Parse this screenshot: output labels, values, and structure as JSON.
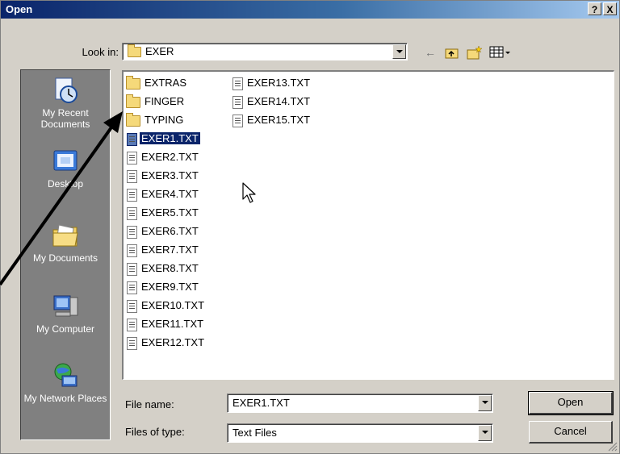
{
  "dialog": {
    "title": "Open",
    "help_label": "?",
    "close_label": "X"
  },
  "lookin": {
    "label": "Look in:",
    "value": "EXER",
    "back_icon": "←",
    "up_icon": "⇪",
    "new_folder_icon": "★",
    "views_icon": "▦"
  },
  "places": [
    {
      "label": "My Recent Documents",
      "icon": "recent-documents-icon"
    },
    {
      "label": "Desktop",
      "icon": "desktop-icon"
    },
    {
      "label": "My Documents",
      "icon": "my-documents-icon"
    },
    {
      "label": "My Computer",
      "icon": "my-computer-icon"
    },
    {
      "label": "My Network Places",
      "icon": "network-places-icon"
    }
  ],
  "files": {
    "column1": [
      {
        "name": "EXTRAS",
        "type": "folder"
      },
      {
        "name": "FINGER",
        "type": "folder"
      },
      {
        "name": "TYPING",
        "type": "folder"
      },
      {
        "name": "EXER1.TXT",
        "type": "text",
        "selected": true
      },
      {
        "name": "EXER2.TXT",
        "type": "text"
      },
      {
        "name": "EXER3.TXT",
        "type": "text"
      },
      {
        "name": "EXER4.TXT",
        "type": "text"
      },
      {
        "name": "EXER5.TXT",
        "type": "text"
      },
      {
        "name": "EXER6.TXT",
        "type": "text"
      },
      {
        "name": "EXER7.TXT",
        "type": "text"
      },
      {
        "name": "EXER8.TXT",
        "type": "text"
      },
      {
        "name": "EXER9.TXT",
        "type": "text"
      },
      {
        "name": "EXER10.TXT",
        "type": "text"
      },
      {
        "name": "EXER11.TXT",
        "type": "text"
      },
      {
        "name": "EXER12.TXT",
        "type": "text"
      }
    ],
    "column2": [
      {
        "name": "EXER13.TXT",
        "type": "text"
      },
      {
        "name": "EXER14.TXT",
        "type": "text"
      },
      {
        "name": "EXER15.TXT",
        "type": "text"
      }
    ]
  },
  "filename": {
    "label": "File name:",
    "value": "EXER1.TXT"
  },
  "filetype": {
    "label": "Files of type:",
    "value": "Text Files"
  },
  "buttons": {
    "open": "Open",
    "cancel": "Cancel"
  },
  "colors": {
    "titlebar": "#0a246a",
    "face": "#d4d0c8",
    "places_bar": "#808080",
    "selection": "#0a246a"
  }
}
